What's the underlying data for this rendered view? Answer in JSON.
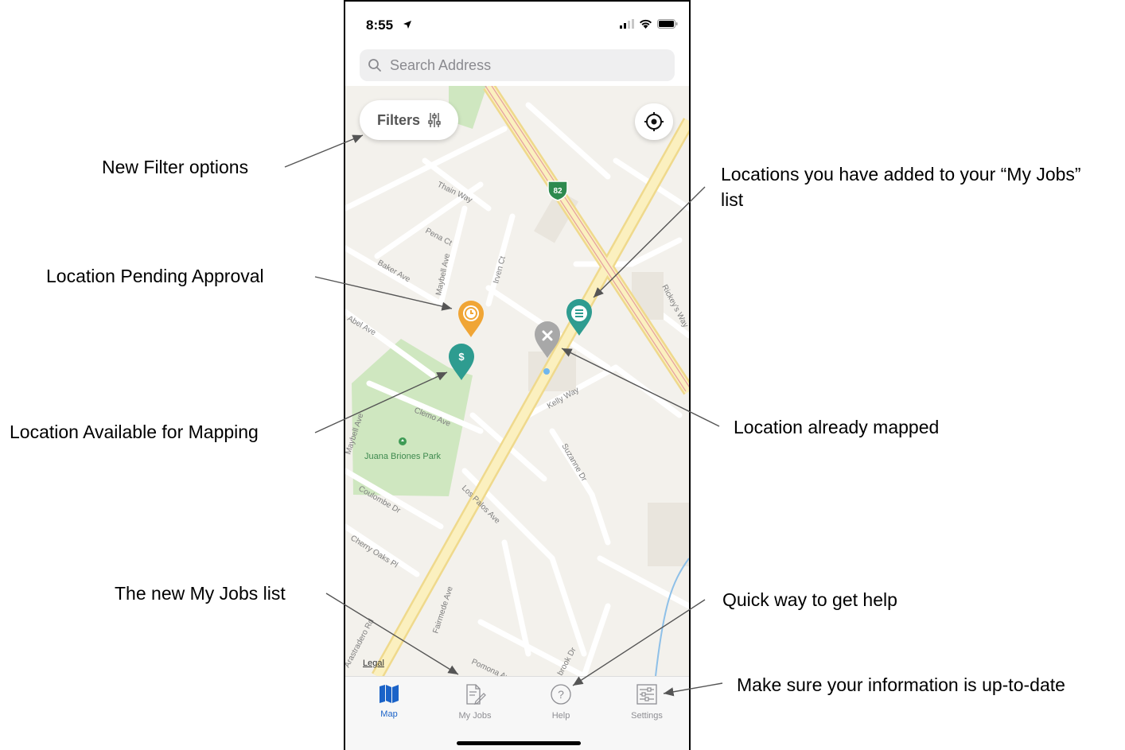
{
  "status": {
    "time": "8:55"
  },
  "search": {
    "placeholder": "Search Address"
  },
  "map": {
    "filters_label": "Filters",
    "legal_label": "Legal",
    "route_badge": "82",
    "park_label": "Juana Briones Park",
    "streets": [
      "Thain Way",
      "Pena Ct",
      "Baker Ave",
      "Maybell Ave",
      "Irven Ct",
      "Abel Ave",
      "Clemo Ave",
      "Coulombe Dr",
      "Cherry Oaks Pl",
      "Los Palos Ave",
      "Kelly Way",
      "Suzanne Dr",
      "Fairmede Ave",
      "Pomona Ave",
      "Rickey's Way",
      "Arastradero Rd",
      "brook Dr",
      "Maybell Ave"
    ],
    "pins": [
      {
        "type": "pending",
        "color": "#f0a535",
        "icon": "clock-icon"
      },
      {
        "type": "available",
        "color": "#2e9c90",
        "icon": "dollar-icon"
      },
      {
        "type": "mapped",
        "color": "#a8a8a8",
        "icon": "x-icon"
      },
      {
        "type": "my-jobs",
        "color": "#2e9c90",
        "icon": "list-icon"
      }
    ]
  },
  "tabs": [
    {
      "label": "Map",
      "icon": "map-icon",
      "active": true
    },
    {
      "label": "My Jobs",
      "icon": "document-edit-icon",
      "active": false
    },
    {
      "label": "Help",
      "icon": "question-circle-icon",
      "active": false
    },
    {
      "label": "Settings",
      "icon": "sliders-icon",
      "active": false
    }
  ],
  "annotations": {
    "filters": "New Filter options",
    "my_jobs_locations": "Locations you have added to your “My Jobs” list",
    "pending": "Location Pending Approval",
    "available": "Location Available for Mapping",
    "mapped": "Location already mapped",
    "my_jobs_list": "The new My Jobs list",
    "help": "Quick way to get help",
    "settings": "Make sure your information is up-to-date"
  },
  "colors": {
    "accent": "#1b63c8",
    "teal": "#2e9c90",
    "orange": "#f0a535",
    "gray": "#a8a8a8",
    "park": "#cfe7c0",
    "road": "#f7e7a9"
  }
}
